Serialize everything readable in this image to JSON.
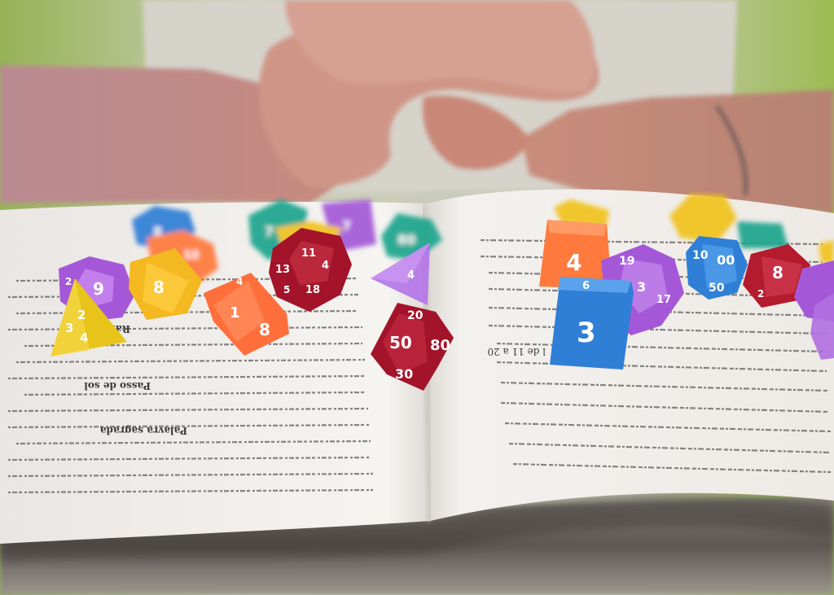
{
  "scene": {
    "description_label": "",
    "colors": {
      "background_green": "#8fae4a",
      "shirt": "#d8d4cc",
      "skin": "#c98f82",
      "page": "#f4f2ee",
      "spine_shadow": "#6f6a66",
      "die_blue": "#2f7fd6",
      "die_red": "#a3142a",
      "die_orange": "#ff7a3c",
      "die_yellow": "#f1c21d",
      "die_purple": "#a458d8",
      "die_teal": "#1fa58e"
    }
  },
  "dice": [
    {
      "name": "blue-d6-center",
      "number": "3",
      "color": "die_blue"
    },
    {
      "name": "red-d10-center",
      "number": "50",
      "color": "die_red"
    },
    {
      "name": "red-d10-center-top",
      "number": "20",
      "color": "die_red"
    },
    {
      "name": "red-d10-center-right",
      "number": "80",
      "color": "die_red"
    },
    {
      "name": "red-d10-center-bottom",
      "number": "30",
      "color": "die_red"
    },
    {
      "name": "orange-d8-left",
      "number": "8",
      "color": "die_orange"
    },
    {
      "name": "orange-d8-left-b",
      "number": "1",
      "color": "die_orange"
    },
    {
      "name": "orange-d8-left-c",
      "number": "4",
      "color": "die_orange"
    },
    {
      "name": "yellow-d4-left",
      "number": "2",
      "color": "die_yellow"
    },
    {
      "name": "yellow-d4-left-b",
      "number": "3",
      "color": "die_yellow"
    },
    {
      "name": "yellow-d4-left-c",
      "number": "4",
      "color": "die_yellow"
    },
    {
      "name": "purple-d12-left",
      "number": "9",
      "color": "die_purple"
    },
    {
      "name": "purple-d12-left-b",
      "number": "2",
      "color": "die_purple"
    },
    {
      "name": "yellow-d8-left",
      "number": "8",
      "color": "die_yellow"
    },
    {
      "name": "red-d20-left",
      "number": "11",
      "color": "die_red"
    },
    {
      "name": "red-d20-left-b",
      "number": "13",
      "color": "die_red"
    },
    {
      "name": "red-d20-left-c",
      "number": "18",
      "color": "die_red"
    },
    {
      "name": "red-d20-left-d",
      "number": "4",
      "color": "die_red"
    },
    {
      "name": "red-d20-left-e",
      "number": "5",
      "color": "die_red"
    },
    {
      "name": "orange-d6-right",
      "number": "4",
      "color": "die_orange"
    },
    {
      "name": "purple-d20-right",
      "number": "19",
      "color": "die_purple"
    },
    {
      "name": "purple-d20-right-b",
      "number": "3",
      "color": "die_purple"
    },
    {
      "name": "purple-d20-right-c",
      "number": "17",
      "color": "die_purple"
    },
    {
      "name": "blue-d6-right-top",
      "number": "6",
      "color": "die_blue"
    },
    {
      "name": "blue-d10-right",
      "number": "00",
      "color": "die_blue"
    },
    {
      "name": "blue-d10-right-b",
      "number": "10",
      "color": "die_blue"
    },
    {
      "name": "blue-d10-right-c",
      "number": "50",
      "color": "die_blue"
    },
    {
      "name": "red-d8-right",
      "number": "8",
      "color": "die_red"
    },
    {
      "name": "red-d8-right-b",
      "number": "2",
      "color": "die_red"
    },
    {
      "name": "teal-d8-left",
      "number": "7",
      "color": "die_teal"
    },
    {
      "name": "teal-d10-left",
      "number": "80",
      "color": "die_teal"
    },
    {
      "name": "purple-d4-left",
      "number": "4",
      "color": "die_purple"
    },
    {
      "name": "purple-d6-left",
      "number": "7",
      "color": "die_purple"
    },
    {
      "name": "orange-d12-left",
      "number": "10",
      "color": "die_orange"
    },
    {
      "name": "blue-d10-left",
      "number": "8",
      "color": "die_blue"
    }
  ],
  "book_text_left": [
    "Palavra sagrada",
    "Passo de sol",
    "Raio de sol"
  ],
  "book_text_right": [
    "l de 11 a 20"
  ]
}
